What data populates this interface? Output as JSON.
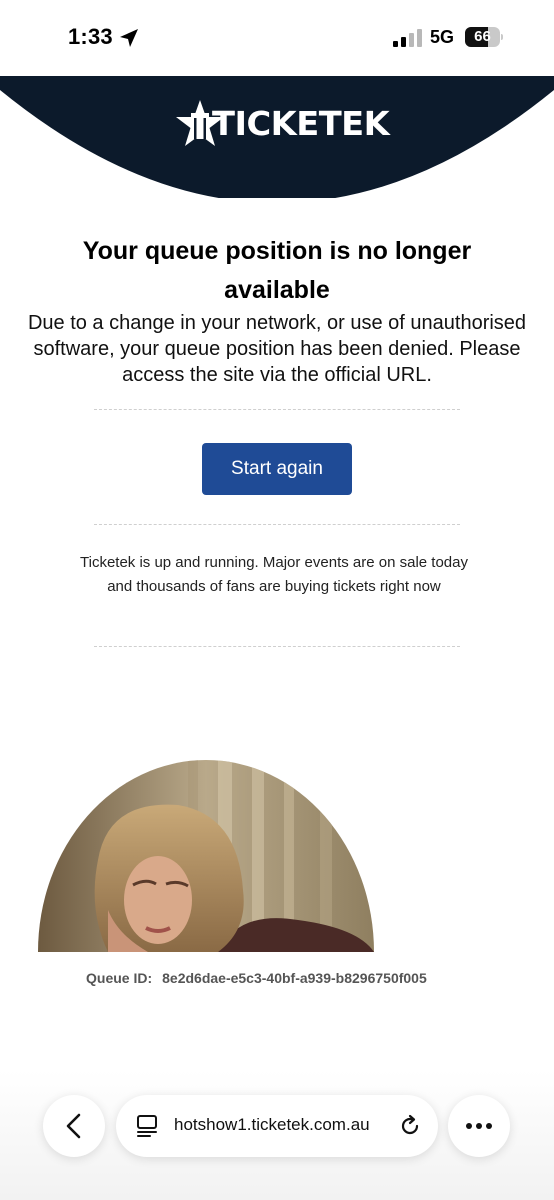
{
  "status_bar": {
    "time": "1:33",
    "network": "5G",
    "battery_level": "66",
    "battery_fraction": 0.66,
    "signal_bars_active": 2,
    "signal_bars_total": 4
  },
  "header": {
    "brand": "TICKETEK",
    "background_color": "#0c1a2b"
  },
  "content": {
    "title": "Your queue position is no longer available",
    "body": "Due to a change in your network, or use of unauthorised software, your queue position has been denied. Please access the site via the official URL.",
    "button_label": "Start again",
    "status_message": "Ticketek is up and running. Major events are on sale today and thousands of fans are buying tickets right now",
    "accent_color": "#1f4b96"
  },
  "queue": {
    "label": "Queue ID:",
    "id": "8e2d6dae-e5c3-40bf-a939-b8296750f005"
  },
  "browser": {
    "url": "hotshow1.ticketek.com.au",
    "icons": [
      "chevron-left-icon",
      "page-menu-icon",
      "reload-icon",
      "more-icon"
    ]
  }
}
